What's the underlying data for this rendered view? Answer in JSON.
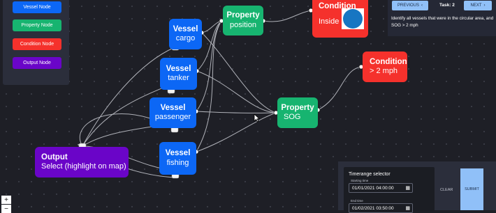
{
  "legend": {
    "items": [
      {
        "label": "Vessel Node",
        "color": "#0c67f5"
      },
      {
        "label": "Property Node",
        "color": "#17b470"
      },
      {
        "label": "Condition Node",
        "color": "#f5312c"
      },
      {
        "label": "Output Node",
        "color": "#6a05c8"
      }
    ]
  },
  "nodes": {
    "vessel_cargo": {
      "title": "Vessel",
      "sub": "cargo"
    },
    "vessel_tanker": {
      "title": "Vessel",
      "sub": "tanker"
    },
    "vessel_passenger": {
      "title": "Vessel",
      "sub": "passenger"
    },
    "vessel_fishing": {
      "title": "Vessel",
      "sub": "fishing"
    },
    "prop_position": {
      "title": "Property",
      "sub": "position"
    },
    "prop_sog": {
      "title": "Property",
      "sub": "SOG"
    },
    "cond_inside": {
      "title": "Condition",
      "sub": "Inside",
      "region_color": "#1776c2"
    },
    "cond_sog": {
      "title": "Condition",
      "sub": "> 2 mph"
    },
    "output": {
      "title": "Output",
      "sub": "Select (highlight on map)"
    }
  },
  "task": {
    "previous_label": "PREVIOUS",
    "next_label": "NEXT",
    "task_label": "Task: 2",
    "description": "Identify all vessels that were in the circular area, and SOG > 2 mph"
  },
  "timerange": {
    "title": "Timerange selector",
    "start_label": "Starting time",
    "start_value": "01/01/2021 04:00:00",
    "end_label": "End time",
    "end_value": "01/02/2021 03:50:00",
    "clear_label": "CLEAR",
    "submit_label": "SUBMIT"
  },
  "zoom": {
    "in_label": "+",
    "out_label": "−"
  }
}
